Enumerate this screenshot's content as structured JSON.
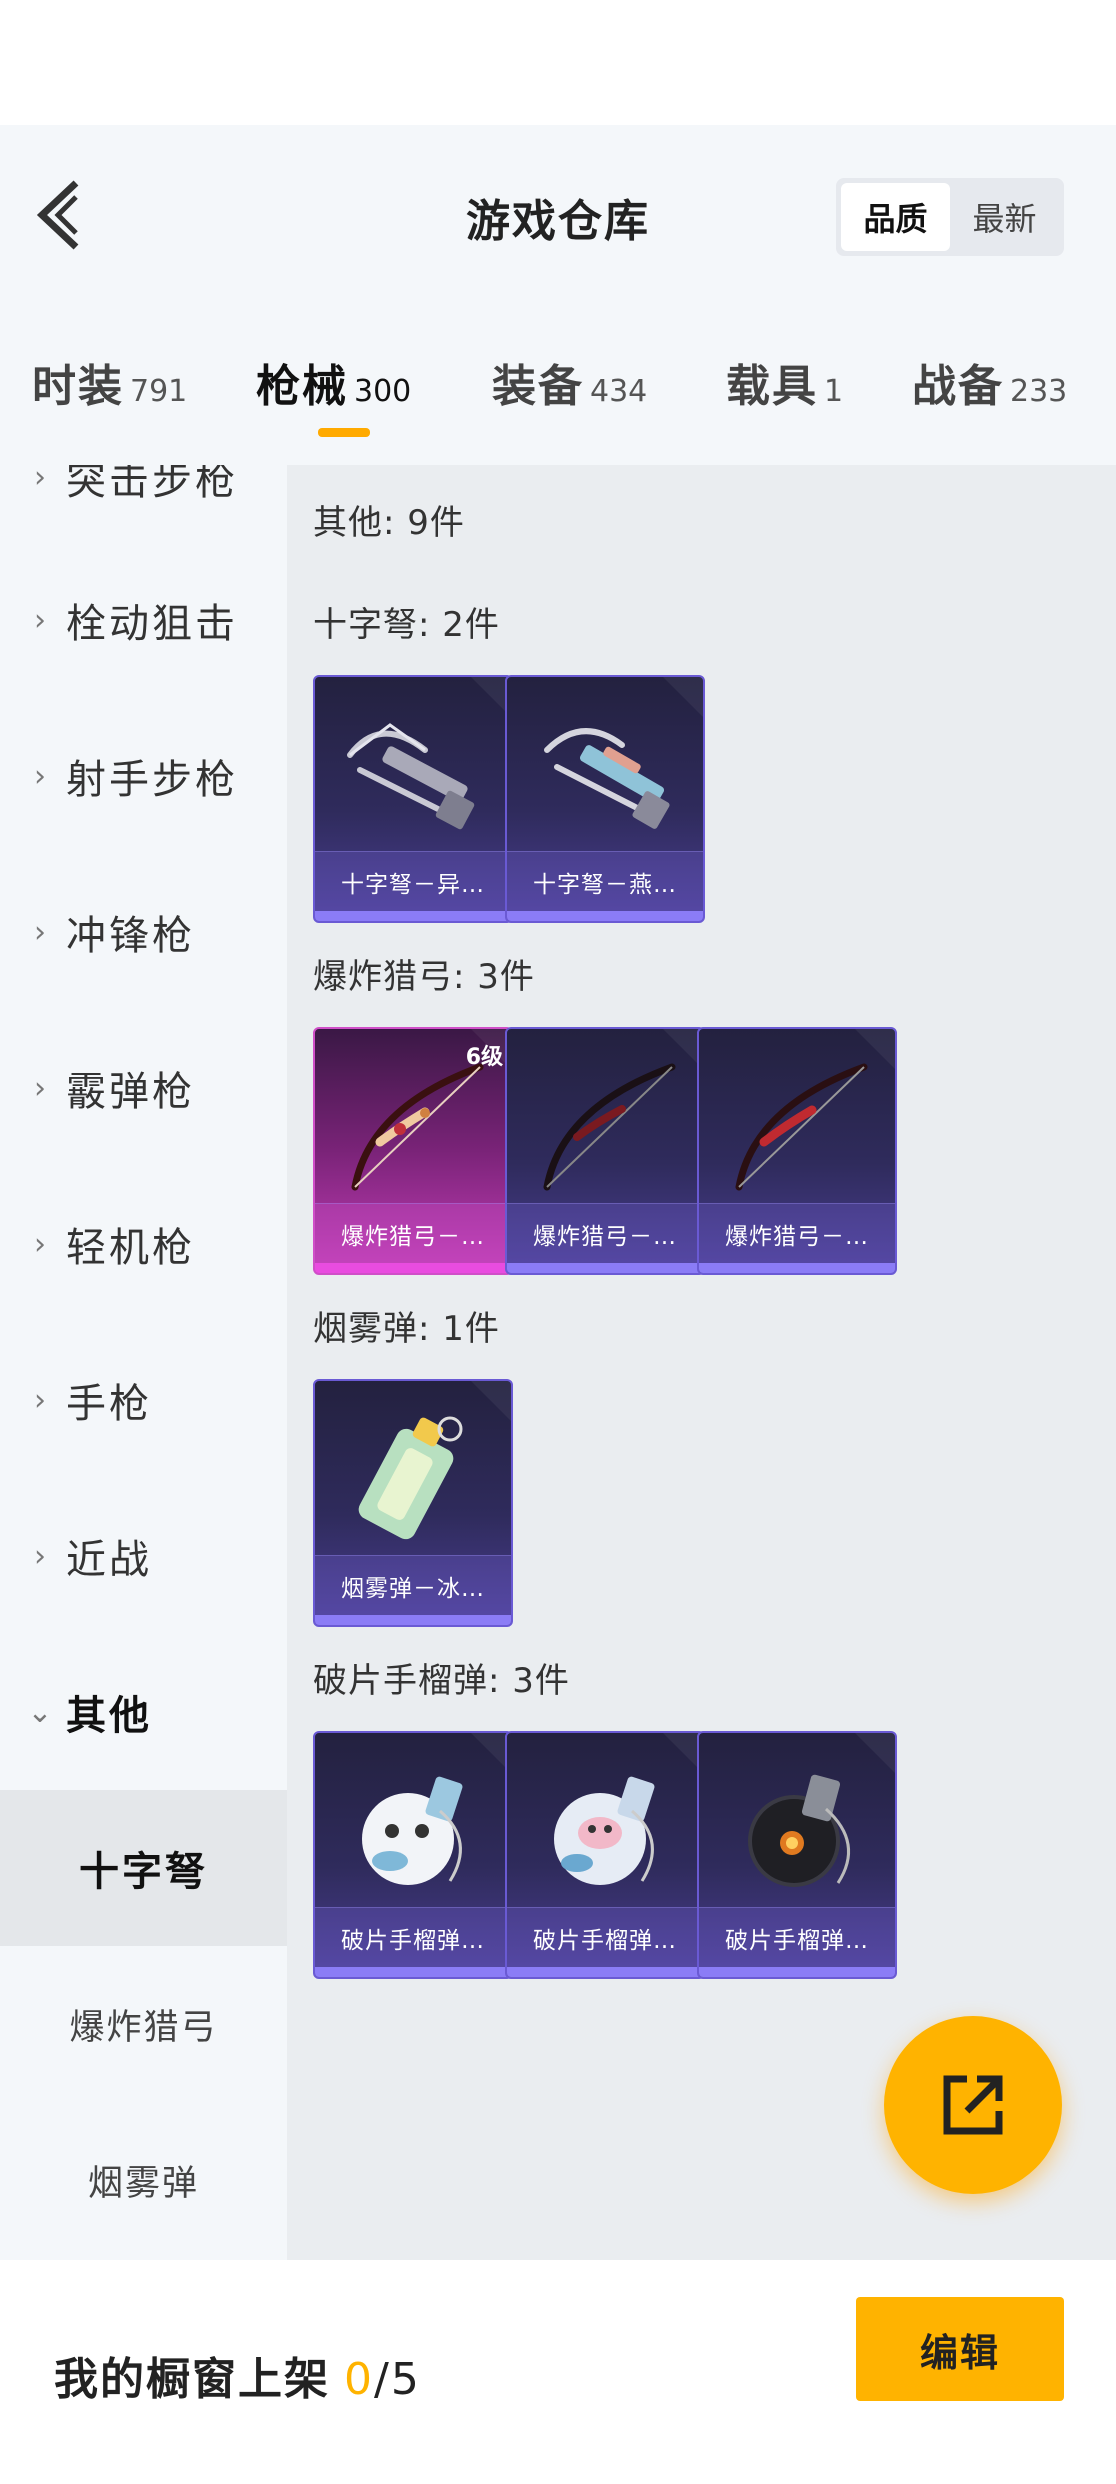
{
  "header": {
    "title": "游戏仓库",
    "sort_options": [
      "品质",
      "最新"
    ],
    "sort_active": "品质"
  },
  "tabs": [
    {
      "label": "时装",
      "count": "791"
    },
    {
      "label": "枪械",
      "count": "300"
    },
    {
      "label": "装备",
      "count": "434"
    },
    {
      "label": "载具",
      "count": "1"
    },
    {
      "label": "战备",
      "count": "233"
    }
  ],
  "sidebar": {
    "partial_item": "突击步枪",
    "items": [
      {
        "label": "栓动狙击"
      },
      {
        "label": "射手步枪"
      },
      {
        "label": "冲锋枪"
      },
      {
        "label": "霰弹枪"
      },
      {
        "label": "轻机枪"
      },
      {
        "label": "手枪"
      },
      {
        "label": "近战"
      },
      {
        "label": "其他"
      }
    ],
    "sub_items": [
      {
        "label": "十字弩"
      },
      {
        "label": "爆炸猎弓"
      },
      {
        "label": "烟雾弹"
      }
    ]
  },
  "main": {
    "section_title": "其他: 9件",
    "groups": [
      {
        "title": "十字弩: 2件",
        "cards": [
          {
            "label": "十字弩－异…",
            "icon": "crossbow-icon"
          },
          {
            "label": "十字弩－燕…",
            "icon": "crossbow-icon"
          }
        ]
      },
      {
        "title": "爆炸猎弓: 3件",
        "cards": [
          {
            "label": "爆炸猎弓－…",
            "icon": "bow-icon",
            "badge": "6级"
          },
          {
            "label": "爆炸猎弓－…",
            "icon": "bow-icon"
          },
          {
            "label": "爆炸猎弓－…",
            "icon": "bow-icon"
          }
        ]
      },
      {
        "title": "烟雾弹: 1件",
        "cards": [
          {
            "label": "烟雾弹－冰…",
            "icon": "smoke-grenade-icon"
          }
        ]
      },
      {
        "title": "破片手榴弹: 3件",
        "cards": [
          {
            "label": "破片手榴弹…",
            "icon": "grenade-icon"
          },
          {
            "label": "破片手榴弹…",
            "icon": "grenade-icon"
          },
          {
            "label": "破片手榴弹…",
            "icon": "grenade-icon"
          }
        ]
      }
    ]
  },
  "footer": {
    "text": "我的橱窗上架",
    "current": "0",
    "total": "/5",
    "edit_label": "编辑"
  },
  "colors": {
    "accent": "#ffb300",
    "card_purple": "#4a3e92",
    "card_pink": "#c53eb8"
  }
}
